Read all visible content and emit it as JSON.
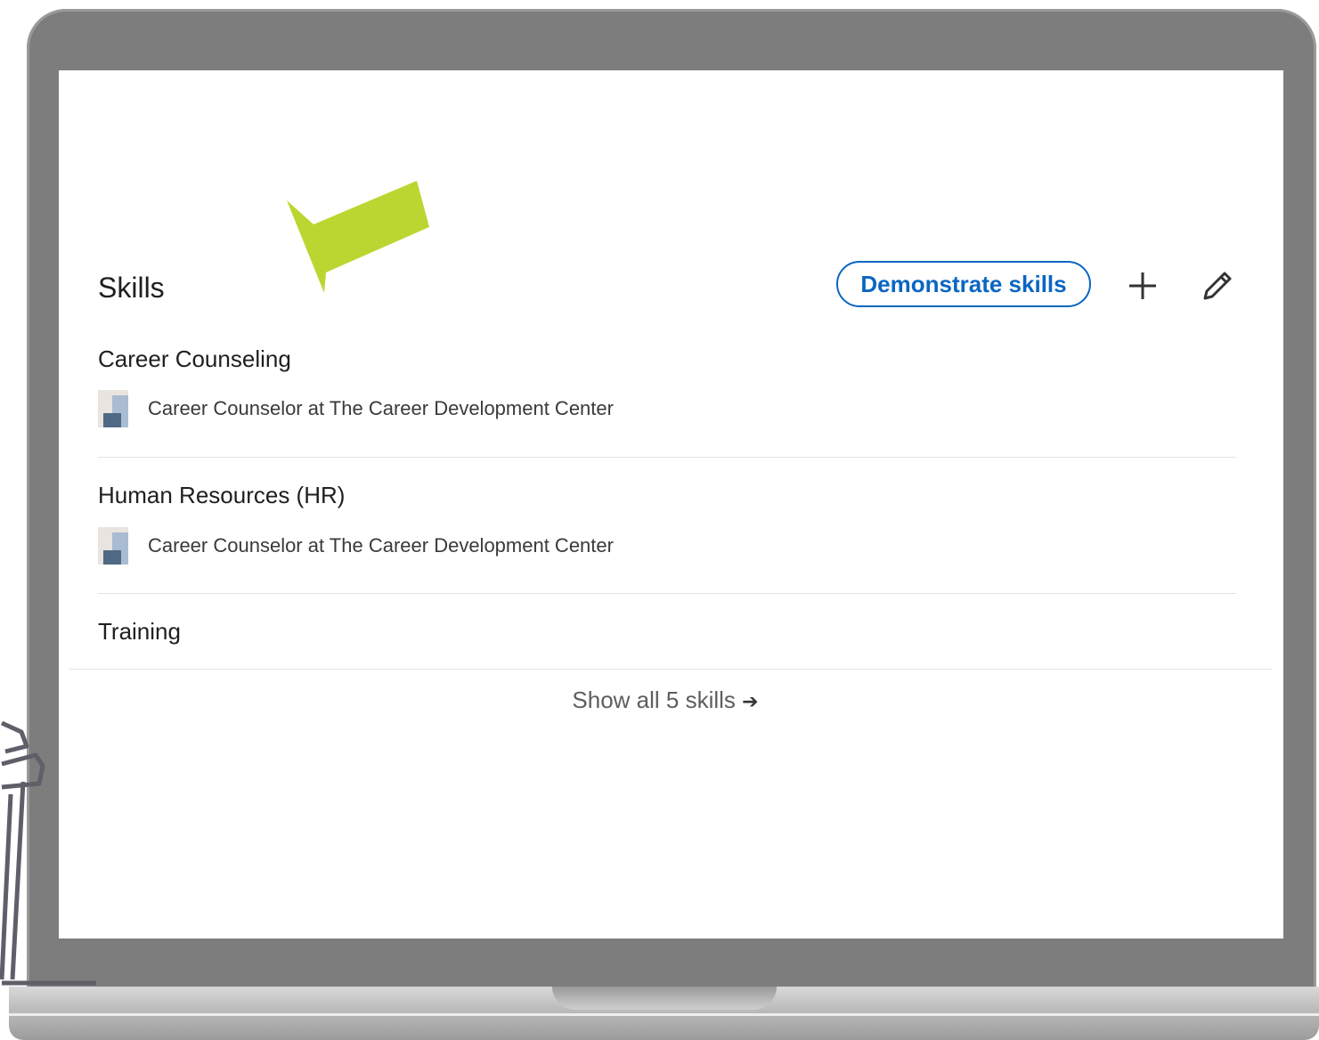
{
  "section": {
    "title": "Skills",
    "demonstrate_label": "Demonstrate skills"
  },
  "skills": [
    {
      "name": "Career Counseling",
      "experience": "Career Counselor at The Career Development Center"
    },
    {
      "name": "Human Resources (HR)",
      "experience": "Career Counselor at The Career Development Center"
    },
    {
      "name": "Training"
    }
  ],
  "footer": {
    "show_all_label": "Show all 5 skills",
    "arrow_glyph": "➔"
  },
  "colors": {
    "accent": "#0a66c2",
    "highlight_arrow": "#bcd631",
    "frame": "#7d7d7d"
  },
  "icons": [
    "add-icon",
    "pencil-icon",
    "company-logo-icon",
    "highlight-arrow-icon",
    "right-arrow-icon"
  ]
}
